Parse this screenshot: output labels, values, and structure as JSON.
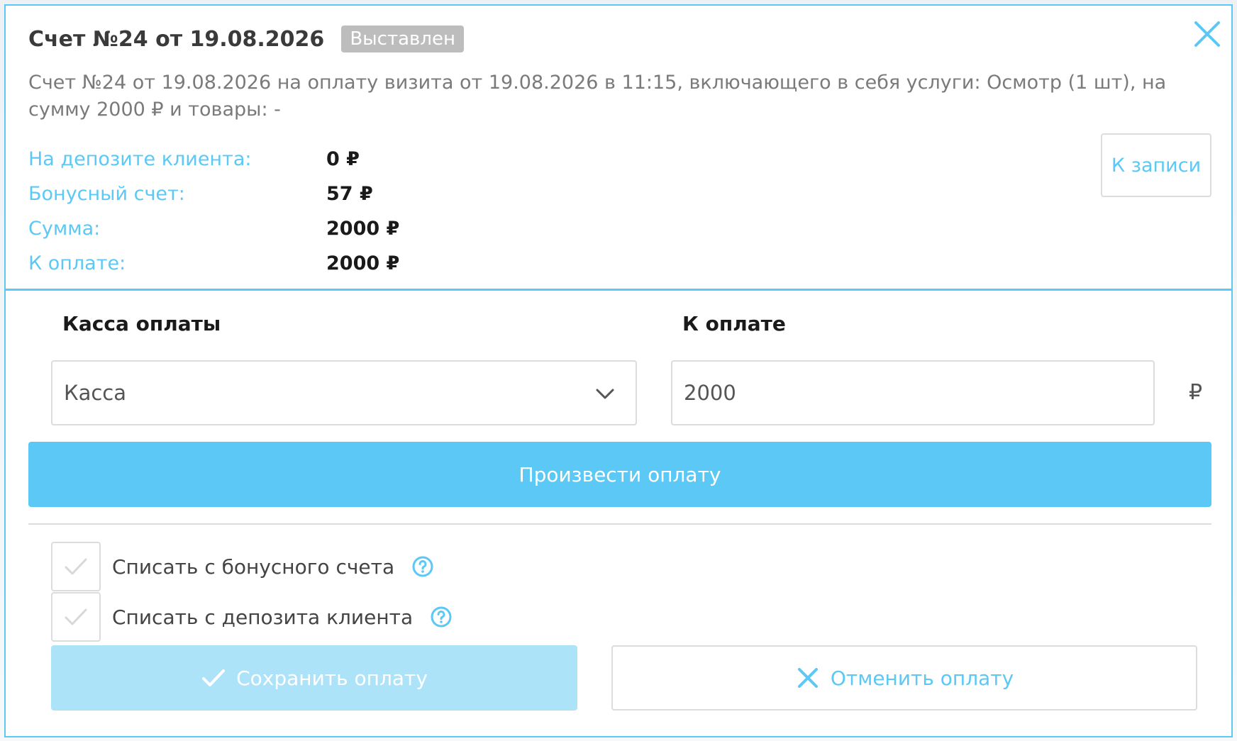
{
  "invoice": {
    "title": "Счет №24 от 19.08.2026",
    "status": "Выставлен",
    "description": "Счет №24 от 19.08.2026 на оплату визита от 19.08.2026 в 11:15, включающего в себя услуги: Осмотр (1 шт), на сумму 2000 ₽ и товары: -",
    "rows": [
      {
        "label": "На депозите клиента:",
        "value": "0 ₽"
      },
      {
        "label": "Бонусный счет:",
        "value": "57 ₽"
      },
      {
        "label": "Сумма:",
        "value": "2000 ₽"
      },
      {
        "label": "К оплате:",
        "value": "2000 ₽"
      }
    ],
    "to_record_label": "К записи"
  },
  "payment": {
    "cashbox_label": "Касса оплаты",
    "cashbox_value": "Касса",
    "amount_label": "К оплате",
    "amount_value": "2000",
    "currency": "₽",
    "pay_button_label": "Произвести оплату"
  },
  "options": {
    "bonus_label": "Списать с бонусного счета",
    "deposit_label": "Списать с депозита клиента"
  },
  "actions": {
    "save_label": "Сохранить оплату",
    "cancel_label": "Отменить оплату"
  },
  "colors": {
    "accent": "#5bc8f5",
    "accent_light": "#ade3f9",
    "badge_gray": "#bdbdbd"
  }
}
